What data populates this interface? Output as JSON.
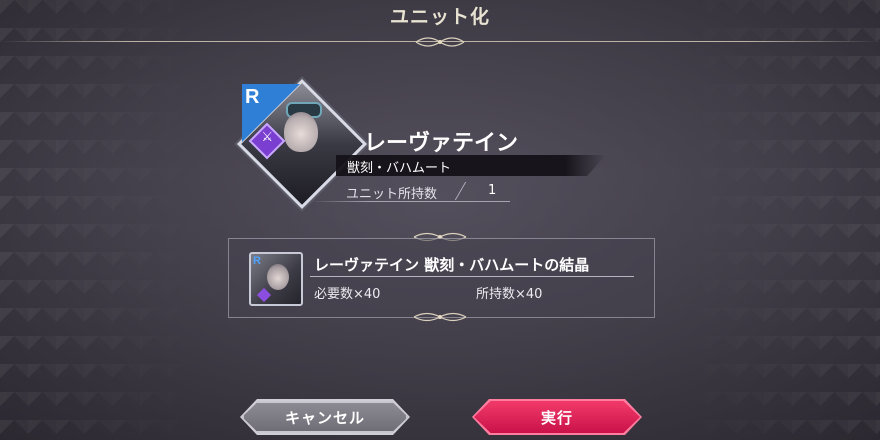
{
  "header": {
    "title": "ユニット化"
  },
  "unit": {
    "rarity": "R",
    "name": "レーヴァテイン",
    "subtitle": "獣刻・バハムート",
    "owned_label": "ユニット所持数",
    "owned_value": "1"
  },
  "crystal": {
    "rarity": "R",
    "name": "レーヴァテイン 獣刻・バハムートの結晶",
    "required": "必要数×40",
    "held": "所持数×40"
  },
  "buttons": {
    "cancel_label": "キャンセル",
    "execute_label": "実行"
  },
  "colors": {
    "execute": "#e0245a",
    "rarity_blue": "#2f7fd6",
    "weapon_purple": "#7a3fd0"
  }
}
